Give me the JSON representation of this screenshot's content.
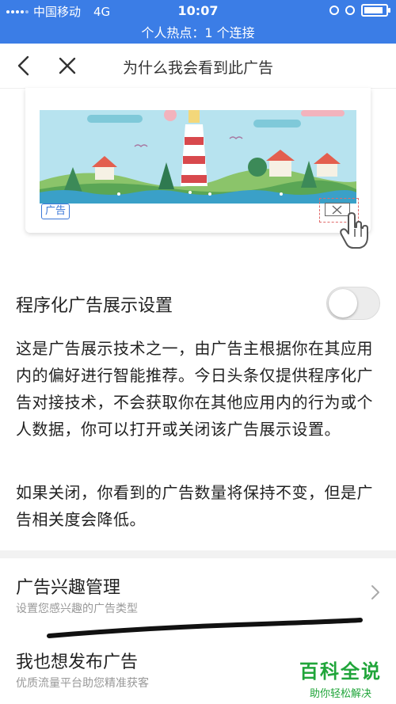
{
  "status_bar": {
    "carrier": "中国移动",
    "network": "4G",
    "time": "10:07",
    "battery_level": 0.9,
    "hotspot_text": "个人热点：1 个连接",
    "background_color": "#3b7de6"
  },
  "nav": {
    "title": "为什么我会看到此广告",
    "back_icon": "chevron-left-icon",
    "close_icon": "close-icon"
  },
  "ad_preview": {
    "badge_label": "广告",
    "close_icon": "close-icon",
    "pointer_icon": "hand-pointer-icon"
  },
  "programmatic_setting": {
    "title": "程序化广告展示设置",
    "toggle_on": false,
    "description": "这是广告展示技术之一，由广告主根据你在其应用内的偏好进行智能推荐。今日头条仅提供程序化广告对接技术，不会获取你在其他应用内的行为或个人数据，你可以打开或关闭该广告展示设置。",
    "note": "如果关闭，你看到的广告数量将保持不变，但是广告相关度会降低。"
  },
  "menu": [
    {
      "title": "广告兴趣管理",
      "subtitle": "设置您感兴趣的广告类型",
      "icon": "chevron-right-icon"
    },
    {
      "title": "我也想发布广告",
      "subtitle": "优质流量平台助您精准获客"
    }
  ],
  "watermark": {
    "title": "百科全说",
    "subtitle": "助你轻松解决",
    "color": "#20a53a"
  }
}
